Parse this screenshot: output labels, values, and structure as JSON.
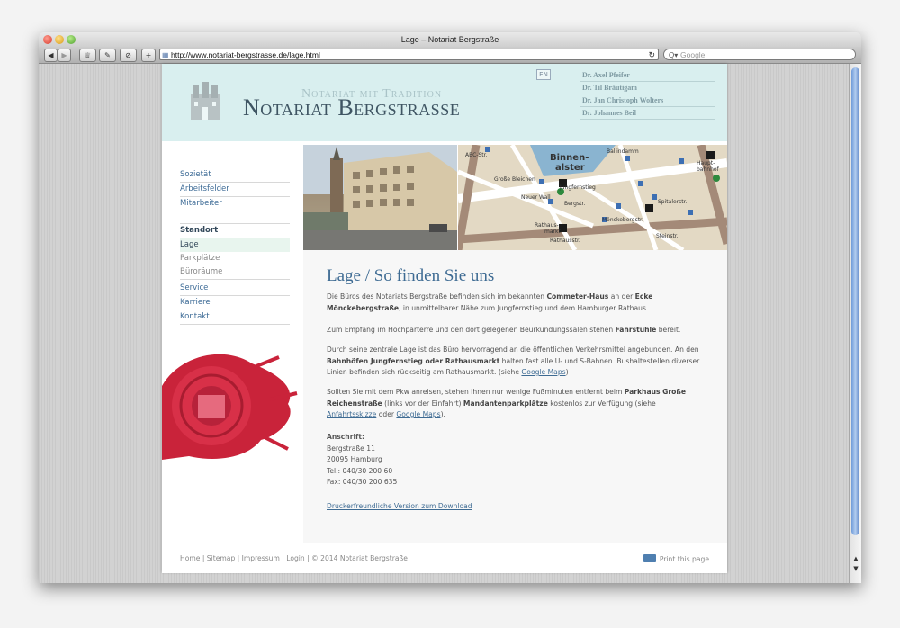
{
  "browser": {
    "window_title": "Lage – Notariat Bergstraße",
    "url": "http://www.notariat-bergstrasse.de/lage.html",
    "search_placeholder": "Google"
  },
  "header": {
    "tagline": "Notariat mit Tradition",
    "title": "Notariat Bergstrasse",
    "lang_button": "EN",
    "partners": [
      "Dr. Axel Pfeifer",
      "Dr. Til Bräutigam",
      "Dr. Jan Christoph Wolters",
      "Dr. Johannes Beil"
    ]
  },
  "nav": {
    "group1": [
      "Sozietät",
      "Arbeitsfelder",
      "Mitarbeiter"
    ],
    "standort_head": "Standort",
    "standort_items": [
      "Lage",
      "Parkplätze",
      "Büroräume"
    ],
    "group3": [
      "Service",
      "Karriere",
      "Kontakt"
    ]
  },
  "map": {
    "labels": [
      "Binnen-",
      "alster",
      "Jungfernstieg",
      "Rathaus-",
      "markt",
      "Mönckebergstr.",
      "Spitalerstr.",
      "Steinstr.",
      "Haupt-",
      "bahnhof",
      "Ballindamm",
      "Große Bleichen",
      "Neuer Wall",
      "Bergstr.",
      "ABC-Str.",
      "Rathausstr."
    ]
  },
  "content": {
    "title": "Lage / So finden Sie uns",
    "p1_a": "Die Büros des Notariats Bergstraße befinden sich im bekannten ",
    "p1_b1": "Commeter-Haus",
    "p1_c": " an der ",
    "p1_b2": "Ecke Mönckebergstraße",
    "p1_d": ", in unmittelbarer Nähe zum Jungfernstieg und dem Hamburger Rathaus.",
    "p2_a": "Zum Empfang im Hochparterre und den dort gelegenen Beurkundungssälen stehen ",
    "p2_b": "Fahrstühle",
    "p2_c": " bereit.",
    "p3_a": "Durch seine zentrale Lage ist das Büro hervorragend an die öffentlichen Verkehrsmittel angebunden. An den ",
    "p3_b": "Bahnhöfen Jungfernstieg oder Rathausmarkt",
    "p3_c": " halten fast alle U- und S-Bahnen. Bushaltestellen diverser Linien befinden sich rückseitig am Rathausmarkt. (siehe ",
    "p3_link": "Google Maps",
    "p3_d": ")",
    "p4_a": "Sollten Sie mit dem Pkw anreisen, stehen Ihnen nur wenige Fußminuten entfernt beim ",
    "p4_b1": "Parkhaus Große Reichenstraße",
    "p4_c": " (links vor der Einfahrt) ",
    "p4_b2": "Mandantenparkplätze",
    "p4_d": " kostenlos zur Verfügung (siehe ",
    "p4_link1": "Anfahrtsskizze",
    "p4_e": " oder ",
    "p4_link2": "Google Maps",
    "p4_f": ").",
    "address_head": "Anschrift:",
    "address_lines": [
      "Bergstraße 11",
      "20095 Hamburg",
      "Tel.: 040/30 200 60",
      "Fax: 040/30 200 635"
    ],
    "download": "Druckerfreundliche Version zum Download"
  },
  "footer": {
    "links": "Home | Sitemap | Impressum | Login | © 2014 Notariat Bergstraße",
    "print": "Print this page"
  }
}
